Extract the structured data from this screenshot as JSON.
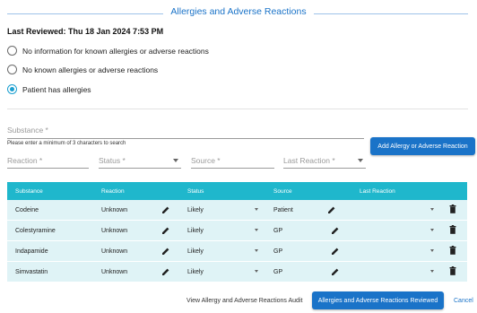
{
  "header": {
    "title": "Allergies and Adverse Reactions"
  },
  "last_reviewed": "Last Reviewed: Thu 18 Jan 2024 7:53 PM",
  "options": [
    {
      "label": "No information for known allergies or adverse reactions",
      "selected": false
    },
    {
      "label": "No known allergies or adverse reactions",
      "selected": false
    },
    {
      "label": "Patient has allergies",
      "selected": true
    }
  ],
  "form": {
    "substance_placeholder": "Substance *",
    "substance_hint": "Please enter a minimum of 3 characters to search",
    "reaction_placeholder": "Reaction *",
    "status_placeholder": "Status *",
    "source_placeholder": "Source *",
    "last_reaction_placeholder": "Last Reaction *",
    "add_button": "Add Allergy or Adverse Reaction"
  },
  "table": {
    "headers": {
      "substance": "Substance",
      "reaction": "Reaction",
      "status": "Status",
      "source": "Source",
      "last_reaction": "Last Reaction"
    },
    "rows": [
      {
        "substance": "Codeine",
        "reaction": "Unknown",
        "status": "Likely",
        "source": "Patient",
        "last_reaction": ""
      },
      {
        "substance": "Colestyramine",
        "reaction": "Unknown",
        "status": "Likely",
        "source": "GP",
        "last_reaction": ""
      },
      {
        "substance": "Indapamide",
        "reaction": "Unknown",
        "status": "Likely",
        "source": "GP",
        "last_reaction": ""
      },
      {
        "substance": "Simvastatin",
        "reaction": "Unknown",
        "status": "Likely",
        "source": "GP",
        "last_reaction": ""
      }
    ]
  },
  "footer": {
    "audit_link": "View Allergy and Adverse Reactions Audit",
    "reviewed_button": "Allergies and Adverse Reactions Reviewed",
    "cancel": "Cancel"
  },
  "colors": {
    "accent": "#1a73c8",
    "table_header": "#1fb7cc",
    "row_bg": "#dff3f6"
  },
  "icons": {
    "edit": "pencil-icon",
    "delete": "trash-icon",
    "dropdown": "caret-down-icon"
  }
}
